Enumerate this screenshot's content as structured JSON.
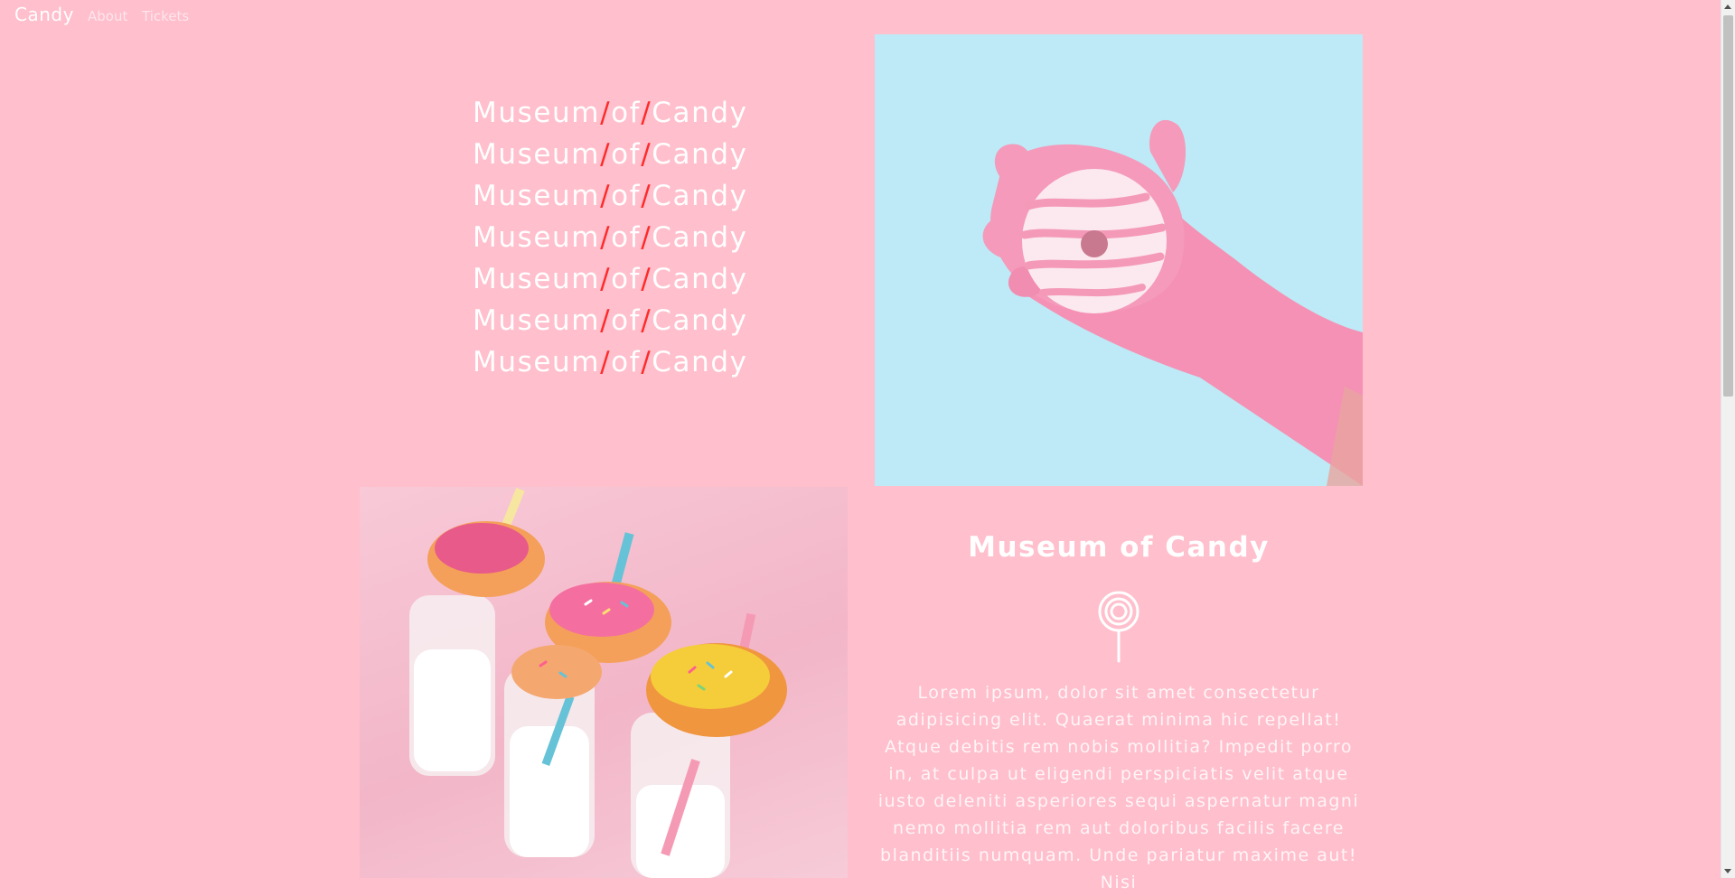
{
  "nav": {
    "brand": "Candy",
    "links": [
      "About",
      "Tickets"
    ]
  },
  "hero": {
    "word1": "Museum",
    "word2": "of",
    "word3": "Candy",
    "separator": "/",
    "separator_color": "#ff2a2a"
  },
  "info": {
    "title": "Museum of Candy",
    "icon": "lollipop-icon",
    "body": "Lorem ipsum, dolor sit amet consectetur adipisicing elit. Quaerat minima hic repellat! Atque debitis rem nobis mollitia? Impedit porro in, at culpa ut eligendi perspiciatis velit atque iusto deleniti asperiores sequi aspernatur magni nemo mollitia rem aut doloribus facilis facere blanditiis numquam. Unde pariatur maxime aut! Nisi"
  },
  "colors": {
    "background": "#ffbfcc",
    "photo_background": "#bdeaf6",
    "text": "#ffffff"
  }
}
